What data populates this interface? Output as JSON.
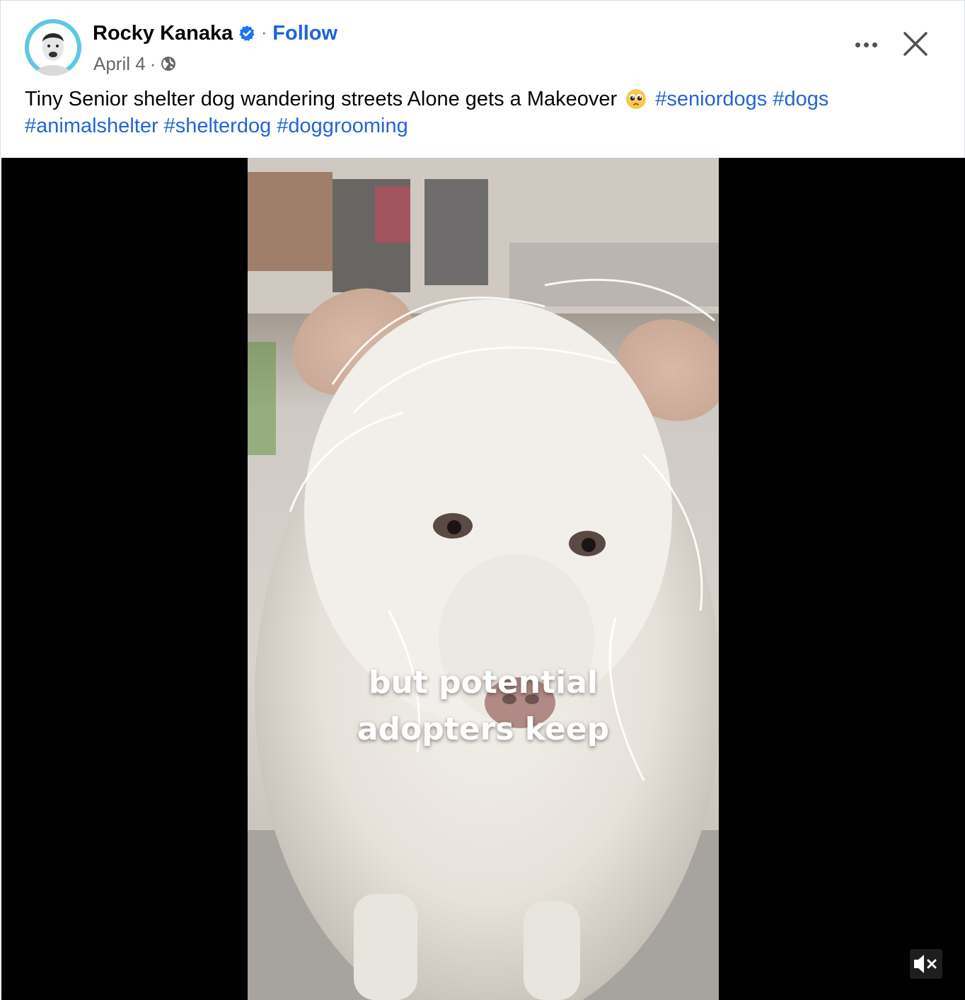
{
  "post": {
    "author": "Rocky Kanaka",
    "separator": "·",
    "follow_label": "Follow",
    "date": "April 4",
    "meta_separator": "·",
    "privacy_icon": "globe-icon",
    "verified_icon": "verified-badge-icon",
    "more_icon": "more-options-icon",
    "close_icon": "close-icon",
    "caption_text": "Tiny Senior shelter dog wandering streets Alone gets a Makeover",
    "caption_emoji": "pleading-face-emoji",
    "hashtags_line1": [
      "#seniordogs",
      "#dogs"
    ],
    "hashtags_line2": [
      "#animalshelter",
      "#shelterdog",
      "#doggrooming"
    ]
  },
  "video": {
    "subtitle_line1": "but potential",
    "subtitle_line2": "adopters keep",
    "mute_icon": "muted-speaker-icon",
    "colors": {
      "background": "#000000",
      "subtitle": "#ffffff"
    }
  },
  "colors": {
    "link": "#2465d4",
    "secondary_text": "#65676b",
    "verified": "#1877f2"
  }
}
